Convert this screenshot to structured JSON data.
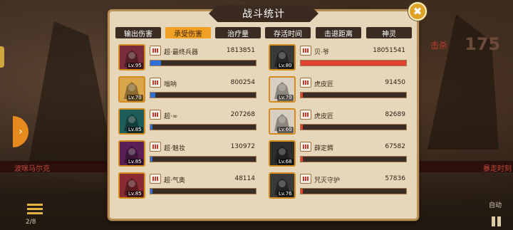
{
  "panel": {
    "title": "战斗统计"
  },
  "close_button": {
    "label": "✖"
  },
  "tabs": [
    {
      "label": "输出伤害",
      "active": false
    },
    {
      "label": "承受伤害",
      "active": true
    },
    {
      "label": "治疗量",
      "active": false
    },
    {
      "label": "存活时间",
      "active": false
    },
    {
      "label": "击退距离",
      "active": false
    },
    {
      "label": "神灵",
      "active": false
    }
  ],
  "left_team": [
    {
      "name": "超·最终兵器",
      "value": "1813851",
      "level": "Lv.95",
      "bar_fraction": 0.1,
      "bar_color": "#2d6fd6",
      "portrait_color": "#7b2c3a"
    },
    {
      "name": "嗡呐",
      "value": "800254",
      "level": "Lv.70",
      "bar_fraction": 0.05,
      "bar_color": "#2d6fd6",
      "portrait_color": "#d8a54b"
    },
    {
      "name": "超·∞",
      "value": "207268",
      "level": "Lv.85",
      "bar_fraction": 0.02,
      "bar_color": "#2d6fd6",
      "portrait_color": "#1e5e5a"
    },
    {
      "name": "超·魅妆",
      "value": "130972",
      "level": "Lv.85",
      "bar_fraction": 0.01,
      "bar_color": "#2d6fd6",
      "portrait_color": "#5b1f55"
    },
    {
      "name": "超·气奥",
      "value": "48114",
      "level": "Lv.85",
      "bar_fraction": 0.005,
      "bar_color": "#2d6fd6",
      "portrait_color": "#8a2a32"
    }
  ],
  "right_team": [
    {
      "name": "贝·爷",
      "value": "18051541",
      "level": "Lv.80",
      "bar_fraction": 1.0,
      "bar_color": "#e2432f",
      "portrait_color": "#3a3a3a"
    },
    {
      "name": "虎皮匠",
      "value": "91450",
      "level": "Lv.70",
      "bar_fraction": 0.006,
      "bar_color": "#e2432f",
      "portrait_color": "#d8cfc2"
    },
    {
      "name": "虎皮匠",
      "value": "82689",
      "level": "Lv.60",
      "bar_fraction": 0.005,
      "bar_color": "#e2432f",
      "portrait_color": "#d8cfc2"
    },
    {
      "name": "薛定鳄",
      "value": "67582",
      "level": "Lv.68",
      "bar_fraction": 0.004,
      "bar_color": "#e2432f",
      "portrait_color": "#2e2e2e"
    },
    {
      "name": "咒灭守护",
      "value": "57836",
      "level": "Lv.76",
      "bar_fraction": 0.003,
      "bar_color": "#e2432f",
      "portrait_color": "#3a3a3a"
    }
  ],
  "background": {
    "left_unit_label": "波咪马尔克",
    "right_unit_label": "暴走时刻",
    "kill_label": "击杀",
    "kill_count": "175",
    "auto_label": "自动",
    "counter_label": "2/8"
  }
}
